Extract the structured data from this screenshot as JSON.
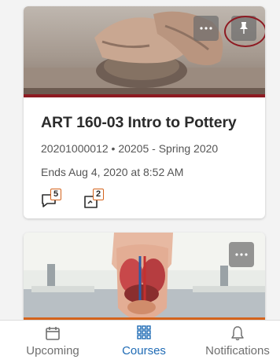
{
  "courses": [
    {
      "title": "ART 160-03 Intro to Pottery",
      "term": "20201000012 • 20205 - Spring 2020",
      "ends": "Ends Aug 4, 2020 at 8:52 AM",
      "discussions_count": "5",
      "assignments_count": "2",
      "image": "pottery-clay-hands",
      "accent_color": "#8e1a22",
      "actions": [
        "more-icon",
        "pin-icon"
      ]
    },
    {
      "image": "anatomy-model-lab",
      "accent_color": "#d4631c",
      "actions": [
        "more-icon"
      ]
    }
  ],
  "nav": {
    "items": [
      {
        "label": "Upcoming",
        "icon": "calendar-icon",
        "active": false
      },
      {
        "label": "Courses",
        "icon": "grid-icon",
        "active": true
      },
      {
        "label": "Notifications",
        "icon": "bell-icon",
        "active": false
      }
    ],
    "active_color": "#1f6bb5",
    "inactive_color": "#6f6f6f"
  },
  "colors": {
    "badge_border": "#d4631c",
    "highlight": "#8e1a22"
  }
}
